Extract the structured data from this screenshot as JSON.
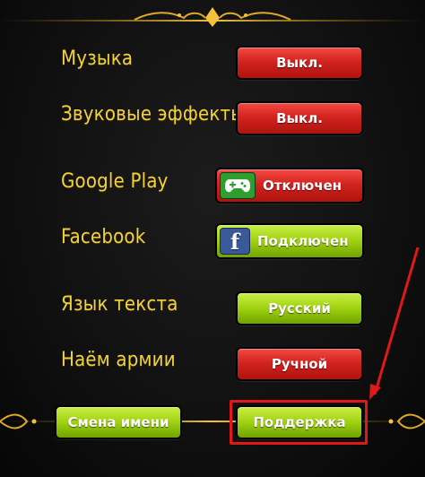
{
  "settings": {
    "music": {
      "label": "Музыка",
      "value": "Выкл."
    },
    "sound_effects": {
      "label": "Звуковые эффекты",
      "value": "Выкл."
    },
    "google_play": {
      "label": "Google Play",
      "value": "Отключен"
    },
    "facebook": {
      "label": "Facebook",
      "value": "Подключен"
    },
    "text_language": {
      "label": "Язык текста",
      "value": "Русский"
    },
    "army_hire": {
      "label": "Наём армии",
      "value": "Ручной"
    }
  },
  "actions": {
    "change_name": "Смена имени",
    "support": "Поддержка"
  },
  "colors": {
    "label": "#f1d23a",
    "button_red": "#d3231f",
    "button_green": "#9fd10f",
    "highlight": "#e01818"
  },
  "icons": [
    "google-play-games-icon",
    "facebook-icon"
  ]
}
